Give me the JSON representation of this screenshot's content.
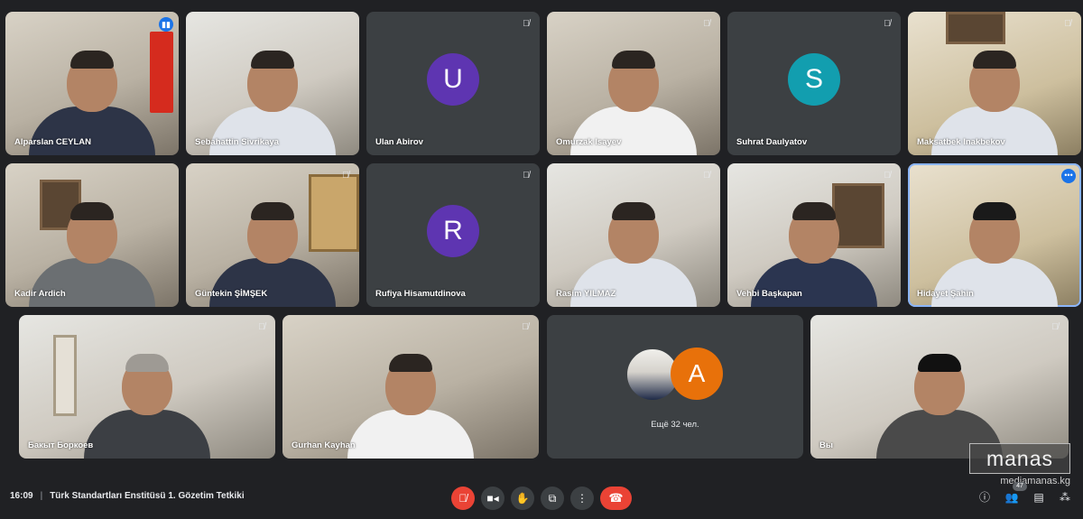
{
  "participants": [
    {
      "name": "Alparslan CEYLAN",
      "status": "speaking"
    },
    {
      "name": "Sebahattin Sivrikaya",
      "status": "camera"
    },
    {
      "name": "Ulan Abirov",
      "initial": "U",
      "avatar_color": "#5e35b1",
      "status": "muted"
    },
    {
      "name": "Omurzak Isayev",
      "status": "muted"
    },
    {
      "name": "Suhrat Daulyatov",
      "initial": "S",
      "avatar_color": "#129eaf",
      "status": "muted"
    },
    {
      "name": "Maksatbek Inakbekov",
      "status": "muted"
    },
    {
      "name": "Kadir Ardich",
      "status": "camera"
    },
    {
      "name": "Güntekin ŞİMŞEK",
      "status": "muted"
    },
    {
      "name": "Rufiya Hisamutdinova",
      "initial": "R",
      "avatar_color": "#5e35b1",
      "status": "muted"
    },
    {
      "name": "Rasim YILMAZ",
      "status": "muted"
    },
    {
      "name": "Vehbi Başkapan",
      "status": "muted"
    },
    {
      "name": "Hidayet Şahin",
      "status": "more-options"
    },
    {
      "name": "Бакыт Боркоев",
      "status": "muted"
    },
    {
      "name": "Gurhan Kayhan",
      "status": "muted"
    },
    {
      "name": "Вы",
      "status": "muted"
    }
  ],
  "others_tile": {
    "initial": "A",
    "avatar_color": "#e8710a",
    "label": "Ещё 32 чел."
  },
  "meeting": {
    "time": "16:09",
    "separator": "|",
    "title": "Türk Standartları Enstitüsü 1. Gözetim Tetkiki"
  },
  "controls": {
    "mic_icon": "mic-off-icon",
    "camera_icon": "videocam-icon",
    "raise_hand_icon": "hand-icon",
    "present_icon": "present-screen-icon",
    "more_icon": "more-vert-icon",
    "hangup_icon": "call-end-icon"
  },
  "right_panel": {
    "people_count": "47"
  },
  "watermark": {
    "logo": "manas",
    "domain": "mediamanas.kg"
  },
  "colors": {
    "background": "#202124",
    "tile": "#3c4043",
    "accent_red": "#ea4335",
    "accent_blue": "#1a73e8"
  }
}
